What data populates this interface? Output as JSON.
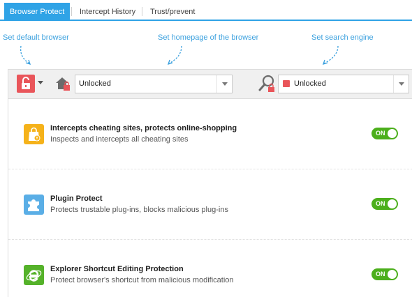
{
  "tabs": [
    {
      "label": "Browser Protect",
      "active": true
    },
    {
      "label": "Intercept History",
      "active": false
    },
    {
      "label": "Trust/prevent",
      "active": false
    }
  ],
  "hints": {
    "default_browser": "Set default browser",
    "homepage": "Set homepage of the browser",
    "search_engine": "Set search engine"
  },
  "toolbar": {
    "homepage_select_value": "Unlocked",
    "search_select_value": "Unlocked"
  },
  "features": [
    {
      "title": "Intercepts cheating sites, protects online-shopping",
      "description": "Inspects and intercepts all cheating sites",
      "toggle": "ON",
      "icon": "shopping-bag-icon",
      "icon_color": "#f5b21a"
    },
    {
      "title": "Plugin Protect",
      "description": "Protects trustable plug-ins, blocks malicious plug-ins",
      "toggle": "ON",
      "icon": "puzzle-piece-icon",
      "icon_color": "#5aaee6"
    },
    {
      "title": "Explorer Shortcut Editing Protection",
      "description": "Protect browser's shortcut from malicious modification",
      "toggle": "ON",
      "icon": "browser-e-icon",
      "icon_color": "#55b22a"
    }
  ],
  "colors": {
    "accent": "#2fa3e6",
    "hint": "#3aa0de",
    "toggle_on": "#4caf1c",
    "lock_red": "#e9555a"
  }
}
